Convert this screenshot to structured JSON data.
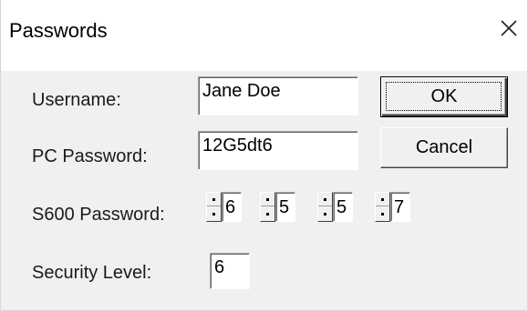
{
  "window": {
    "title": "Passwords",
    "close_icon": "close-icon"
  },
  "fields": {
    "username": {
      "label": "Username:",
      "value": "Jane Doe"
    },
    "pc_password": {
      "label": "PC Password:",
      "value": "12G5dt6"
    },
    "s600_password": {
      "label": "S600 Password:",
      "digits": [
        "6",
        "5",
        "5",
        "7"
      ]
    },
    "security_level": {
      "label": "Security Level:",
      "value": "6"
    }
  },
  "buttons": {
    "ok": "OK",
    "cancel": "Cancel"
  }
}
